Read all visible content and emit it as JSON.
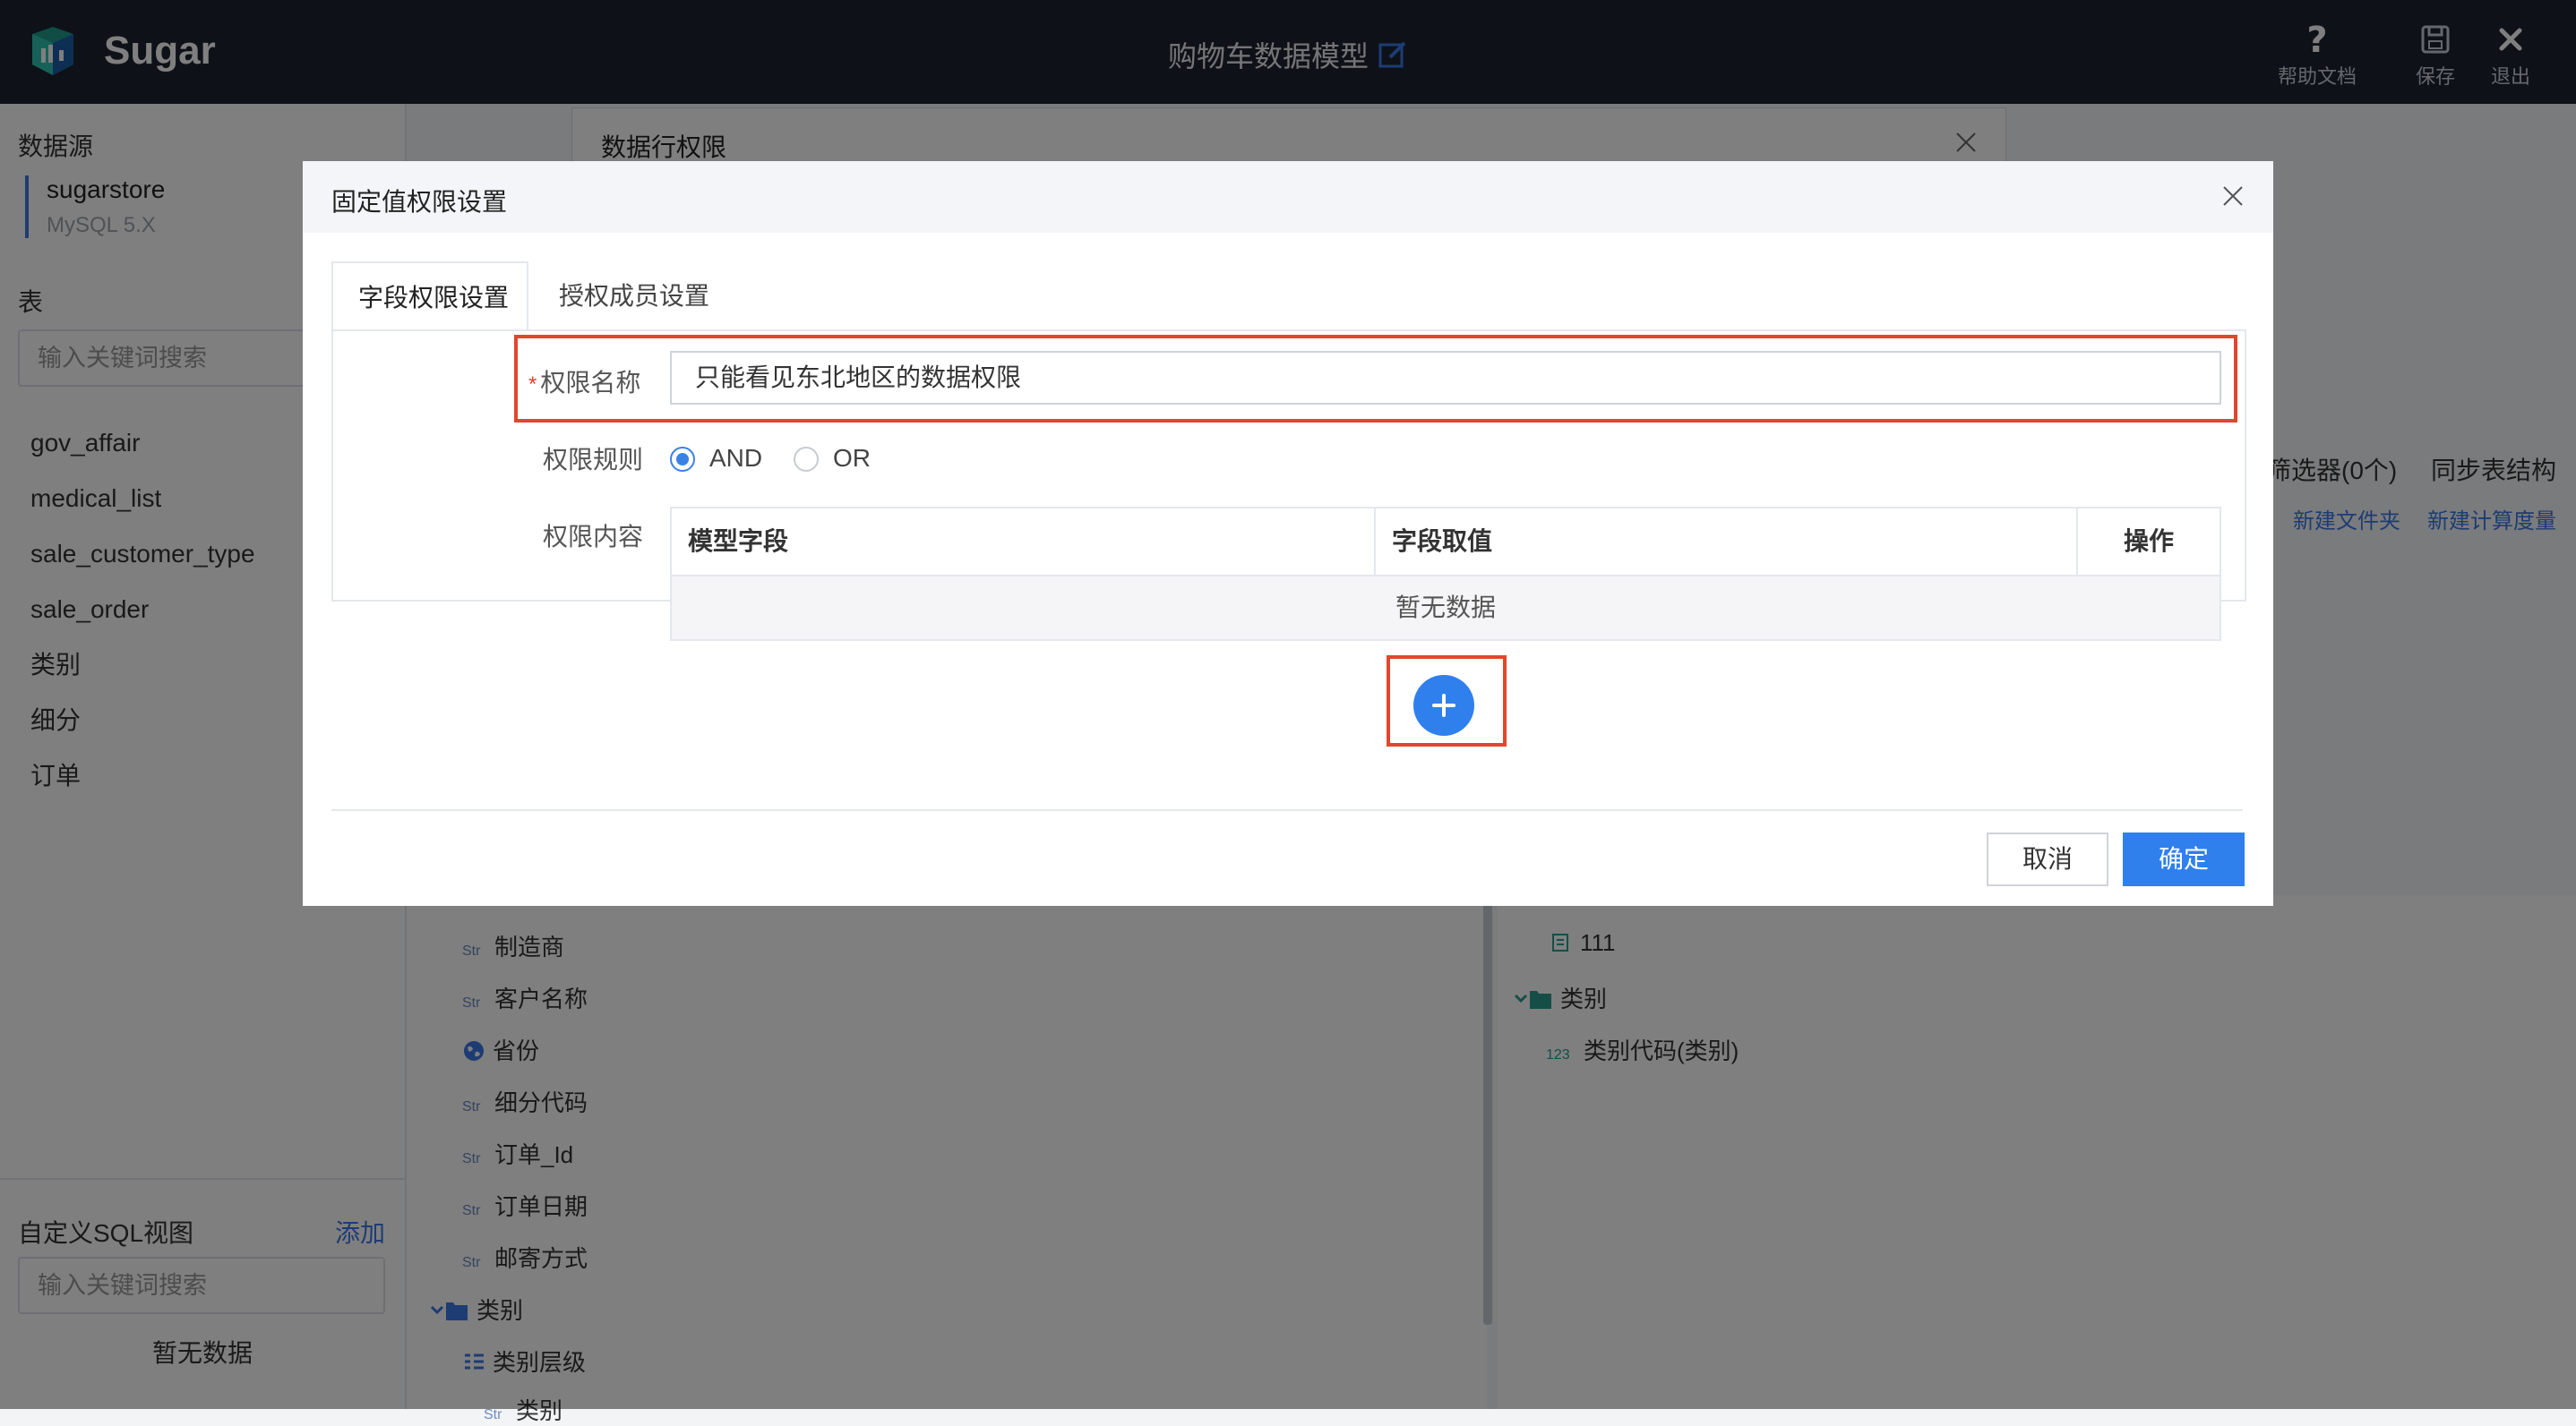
{
  "app": {
    "name": "Sugar",
    "page_title": "购物车数据模型"
  },
  "topbar": {
    "help_label": "帮助文档",
    "save_label": "保存",
    "exit_label": "退出"
  },
  "sidebar": {
    "datasource_heading": "数据源",
    "datasource_name": "sugarstore",
    "datasource_type": "MySQL 5.X",
    "tables_heading": "表",
    "search_placeholder": "输入关键词搜索",
    "tables": [
      "gov_affair",
      "medical_list",
      "sale_customer_type",
      "sale_order",
      "类别",
      "细分",
      "订单"
    ],
    "sql_view_heading": "自定义SQL视图",
    "add_label": "添加",
    "sql_search_placeholder": "输入关键词搜索",
    "sql_empty": "暂无数据"
  },
  "background": {
    "toolbar_filter": "筛选器(0个)",
    "toolbar_sync": "同步表结构",
    "new_folder": "新建文件夹",
    "new_measure": "新建计算度量",
    "left_fields": [
      {
        "type": "Str",
        "label": "制造商"
      },
      {
        "type": "Str",
        "label": "客户名称"
      },
      {
        "type": "geo",
        "label": "省份"
      },
      {
        "type": "Str",
        "label": "细分代码"
      },
      {
        "type": "Str",
        "label": "订单_Id"
      },
      {
        "type": "Str",
        "label": "订单日期"
      },
      {
        "type": "Str",
        "label": "邮寄方式"
      },
      {
        "type": "folder",
        "label": "类别"
      },
      {
        "type": "hierarchy",
        "label": "类别层级"
      },
      {
        "type": "Str",
        "label": "类别"
      }
    ],
    "right_fields": [
      {
        "type": "calc",
        "label": "111"
      },
      {
        "type": "folder",
        "label": "类别"
      },
      {
        "type": "123",
        "label": "类别代码(类别)"
      }
    ]
  },
  "back_modal": {
    "title": "数据行权限"
  },
  "dialog": {
    "title": "固定值权限设置",
    "tabs": [
      "字段权限设置",
      "授权成员设置"
    ],
    "name_label": "权限名称",
    "name_required_mark": "*",
    "name_value": "只能看见东北地区的数据权限",
    "rule_label": "权限规则",
    "rule_options": [
      "AND",
      "OR"
    ],
    "rule_selected": "AND",
    "content_label": "权限内容",
    "table_columns": [
      "模型字段",
      "字段取值",
      "操作"
    ],
    "table_empty": "暂无数据",
    "cancel_label": "取消",
    "ok_label": "确定"
  },
  "colors": {
    "accent": "#2f80ed",
    "highlight": "#e2462c",
    "topbar": "#1c2430"
  }
}
